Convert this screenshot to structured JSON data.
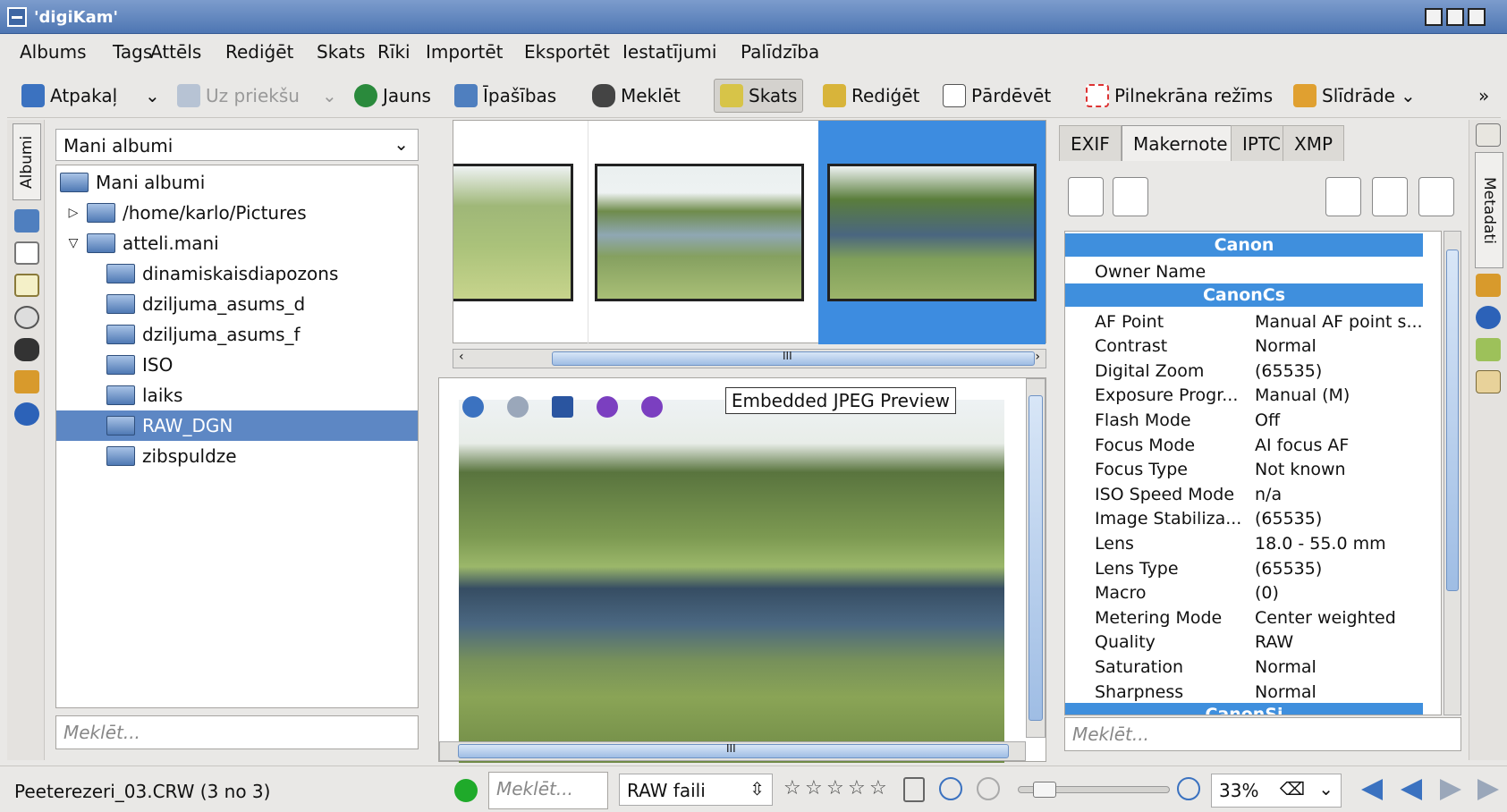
{
  "window": {
    "title": "'digiKam'"
  },
  "menu": [
    "Albums",
    "Tags",
    "Attēls",
    "Rediģēt",
    "Skats",
    "Rīki",
    "Importēt",
    "Eksportēt",
    "Iestatījumi",
    "Palīdzība"
  ],
  "toolbar": {
    "back": "Atpakaļ",
    "forward": "Uz priekšu",
    "new": "Jauns",
    "properties": "Īpašības",
    "search": "Meklēt",
    "view": "Skats",
    "edit": "Rediģēt",
    "rename": "Pārdēvēt",
    "fullscreen": "Pilnekrāna režīms",
    "slideshow": "Slīdrāde"
  },
  "left_tabs": {
    "albums": "Albumi"
  },
  "albums": {
    "selector": "Mani albumi",
    "search_placeholder": "Meklēt...",
    "tree": [
      {
        "label": "Mani albumi",
        "depth": 0,
        "expander": ""
      },
      {
        "label": "/home/karlo/Pictures",
        "depth": 1,
        "expander": "▷"
      },
      {
        "label": "atteli.mani",
        "depth": 1,
        "expander": "▽"
      },
      {
        "label": "dinamiskaisdiapozons",
        "depth": 2,
        "expander": ""
      },
      {
        "label": "dziljuma_asums_d",
        "depth": 2,
        "expander": ""
      },
      {
        "label": "dziljuma_asums_f",
        "depth": 2,
        "expander": ""
      },
      {
        "label": "ISO",
        "depth": 2,
        "expander": ""
      },
      {
        "label": "laiks",
        "depth": 2,
        "expander": ""
      },
      {
        "label": "RAW_DGN",
        "depth": 2,
        "expander": "",
        "selected": true
      },
      {
        "label": "zibspuldze",
        "depth": 2,
        "expander": ""
      }
    ]
  },
  "thumbbar": {
    "scroll_grip": "III"
  },
  "preview": {
    "mode_label": "Embedded JPEG Preview",
    "scroll_grip": "III"
  },
  "right_tabs": {
    "metadata": "Metadati"
  },
  "metadata": {
    "tabs": [
      {
        "label": "EXIF",
        "active": false
      },
      {
        "label": "Makernote",
        "active": true
      },
      {
        "label": "IPTC",
        "active": false
      },
      {
        "label": "XMP",
        "active": false
      }
    ],
    "groups": [
      {
        "title": "Canon",
        "rows": [
          {
            "k": "Owner Name",
            "v": ""
          }
        ]
      },
      {
        "title": "CanonCs",
        "rows": [
          {
            "k": "AF Point",
            "v": "Manual AF point s..."
          },
          {
            "k": "Contrast",
            "v": "Normal"
          },
          {
            "k": "Digital Zoom",
            "v": "(65535)"
          },
          {
            "k": "Exposure Progr...",
            "v": "Manual (M)"
          },
          {
            "k": "Flash Mode",
            "v": "Off"
          },
          {
            "k": "Focus Mode",
            "v": "AI focus AF"
          },
          {
            "k": "Focus Type",
            "v": "Not known"
          },
          {
            "k": "ISO Speed Mode",
            "v": "n/a"
          },
          {
            "k": "Image Stabiliza...",
            "v": "(65535)"
          },
          {
            "k": "Lens",
            "v": "18.0 - 55.0 mm"
          },
          {
            "k": "Lens Type",
            "v": "(65535)"
          },
          {
            "k": "Macro",
            "v": "(0)"
          },
          {
            "k": "Metering Mode",
            "v": "Center weighted"
          },
          {
            "k": "Quality",
            "v": "RAW"
          },
          {
            "k": "Saturation",
            "v": "Normal"
          },
          {
            "k": "Sharpness",
            "v": "Normal"
          }
        ]
      },
      {
        "title": "CanonSi",
        "rows": []
      }
    ],
    "search_placeholder": "Meklēt..."
  },
  "status": {
    "file": "Peeterezeri_03.CRW (3 no 3)",
    "search_placeholder": "Meklēt...",
    "filter": "RAW faili",
    "rating_stars": 5,
    "zoom": "33%",
    "zoom_level": 0.33,
    "colors": {
      "status_dot": "#1faa2a"
    }
  }
}
